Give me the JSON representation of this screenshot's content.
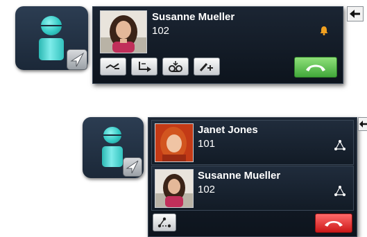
{
  "call1": {
    "caller": {
      "name": "Susanne Mueller",
      "extension": "102"
    },
    "controls": [
      "hold",
      "transfer",
      "voicemail",
      "add-participant"
    ],
    "answer_button_color": "#41a83a",
    "alert_icon_color": "#f0a020"
  },
  "call2": {
    "participants": [
      {
        "name": "Janet Jones",
        "extension": "101"
      },
      {
        "name": "Susanne Mueller",
        "extension": "102"
      }
    ],
    "hangup_button_color": "#cc1818"
  },
  "colors": {
    "panel_bg": "#121b26",
    "user_icon": "#33c9c4",
    "text": "#ffffff"
  }
}
